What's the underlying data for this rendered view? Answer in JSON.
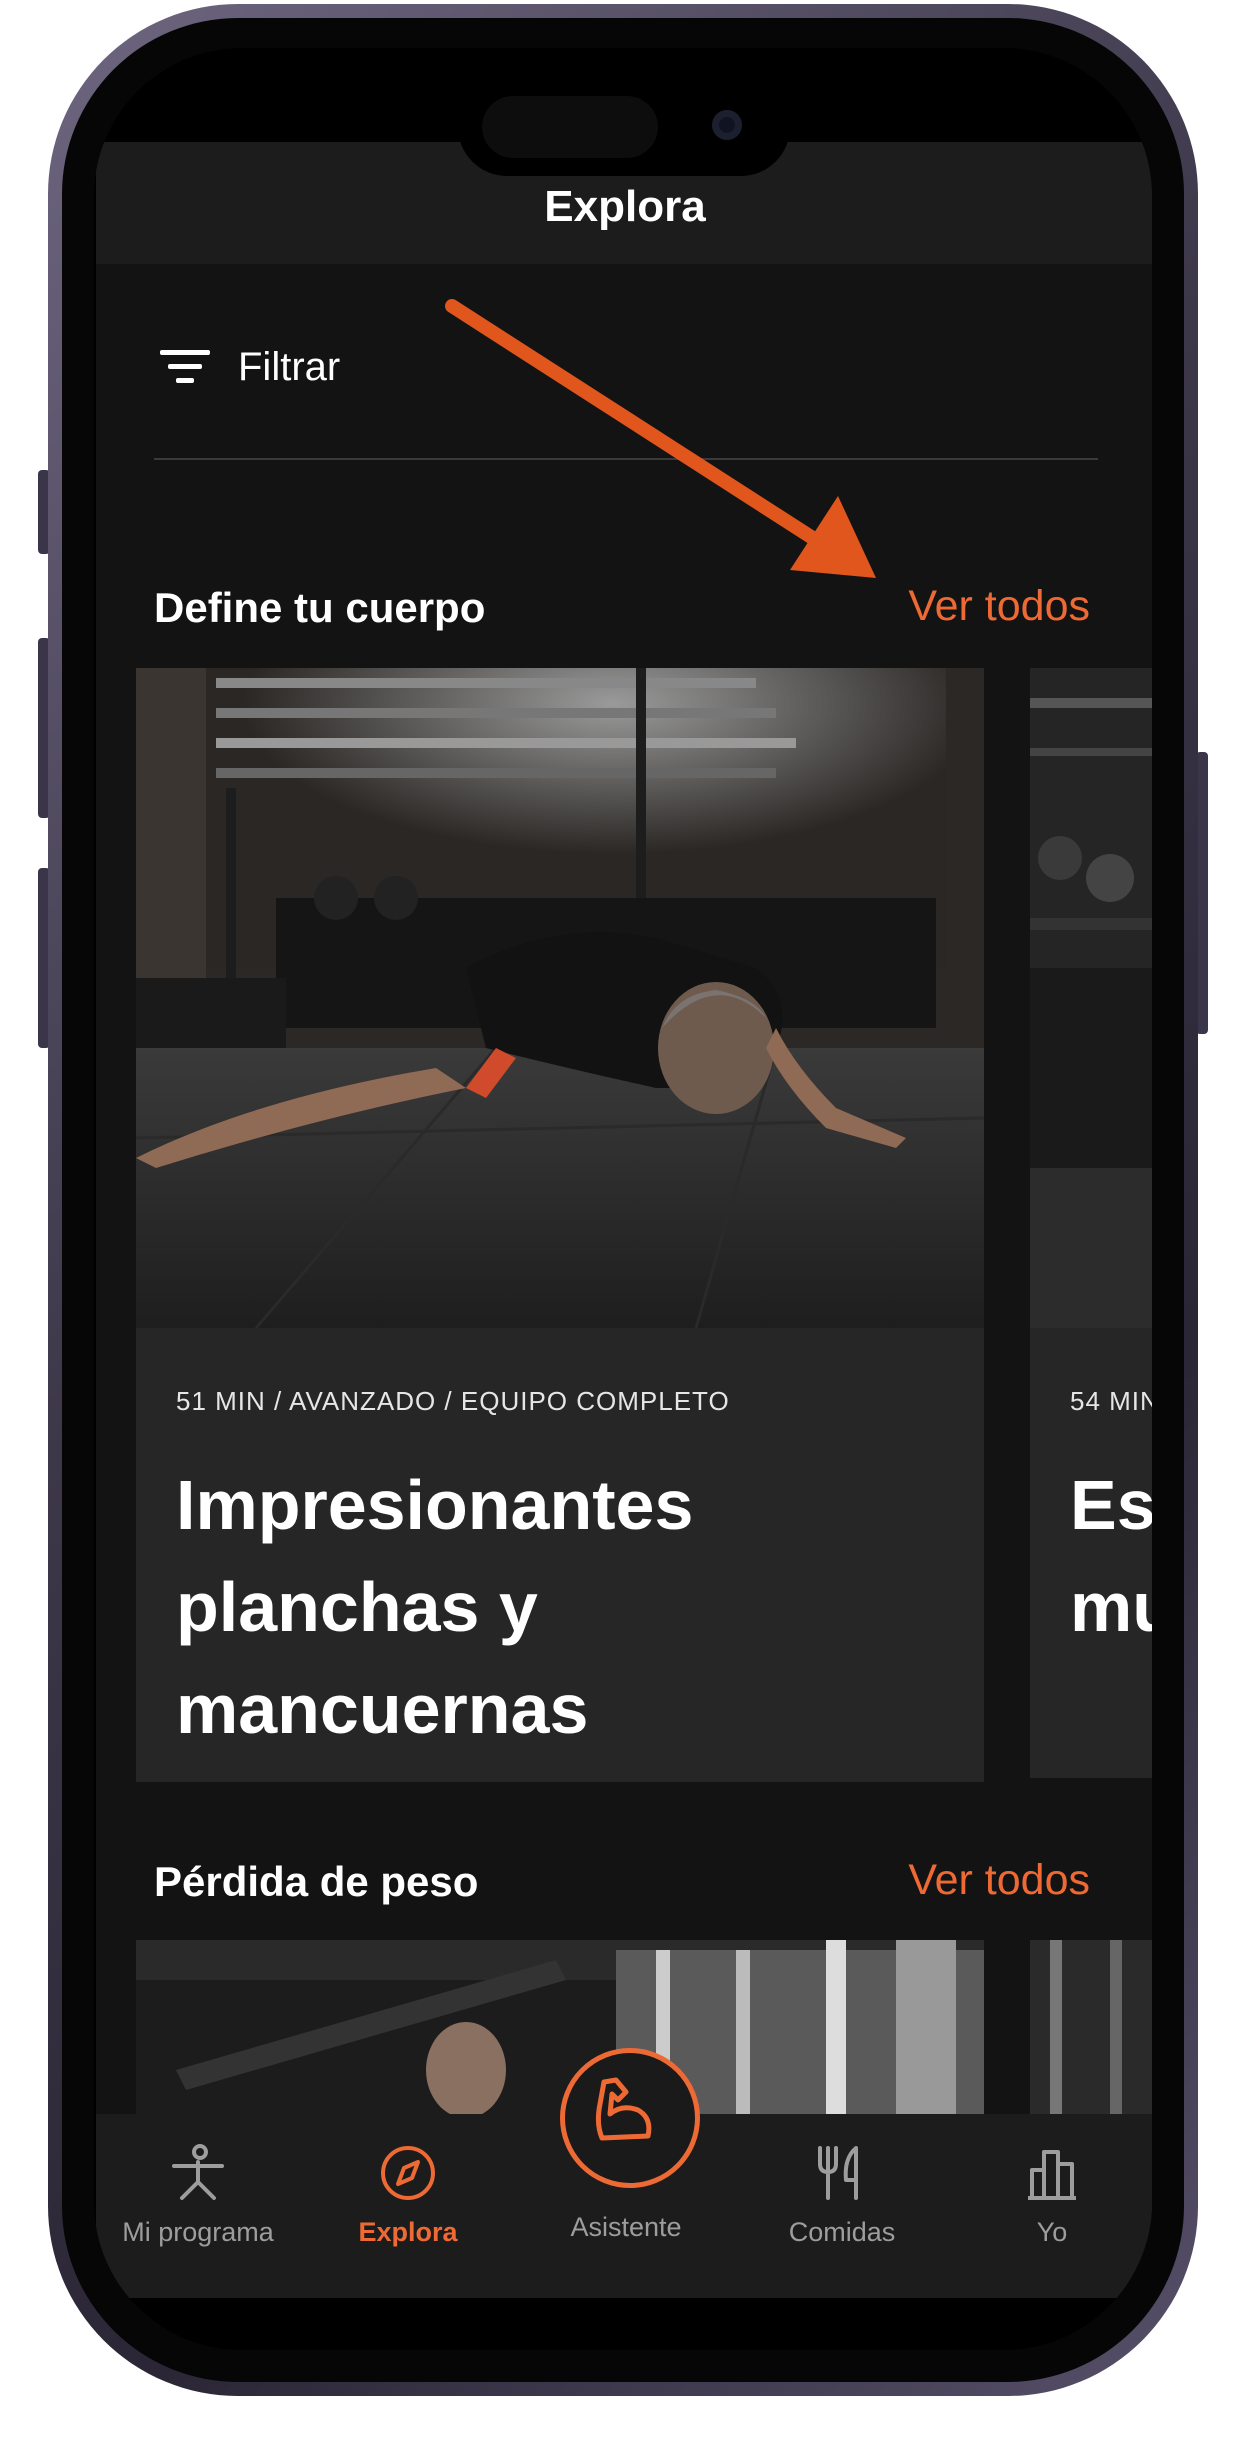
{
  "header": {
    "title": "Explora"
  },
  "filter": {
    "label": "Filtrar"
  },
  "sections": [
    {
      "title": "Define tu cuerpo",
      "link": "Ver todos",
      "cards": [
        {
          "meta": "51 MIN / AVANZADO / EQUIPO COMPLETO",
          "title": "Impresionantes\nplanchas y\nmancuernas"
        },
        {
          "meta": "54 MIN",
          "title": "Esp\nmu"
        }
      ]
    },
    {
      "title": "Pérdida de peso",
      "link": "Ver todos"
    }
  ],
  "tabs": [
    {
      "label": "Mi programa",
      "icon": "stretch-person-icon"
    },
    {
      "label": "Explora",
      "icon": "compass-icon",
      "active": true
    },
    {
      "label": "Asistente",
      "icon": "flexed-arm-icon"
    },
    {
      "label": "Comidas",
      "icon": "fork-knife-icon"
    },
    {
      "label": "Yo",
      "icon": "bar-chart-icon"
    }
  ],
  "colors": {
    "accent": "#ee6a35",
    "background": "#131313",
    "card": "#262626",
    "annotation_arrow": "#e0561c"
  }
}
